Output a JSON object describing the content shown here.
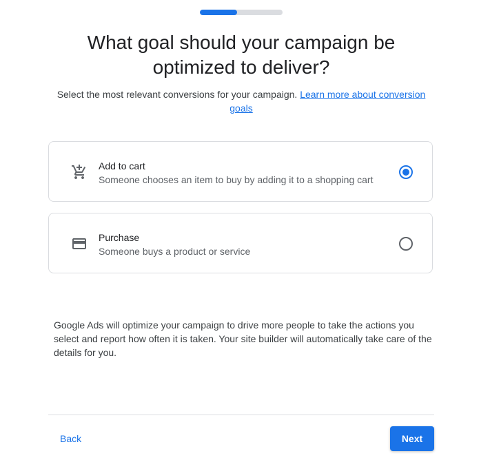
{
  "progress": {
    "fraction": 0.45,
    "track_color": "#dadce0",
    "fill_color": "#1a73e8"
  },
  "header": {
    "title": "What goal should your campaign be optimized to deliver?",
    "subtitle_text": "Select the most relevant conversions for your campaign.",
    "learn_more_link": "Learn more about conversion goals"
  },
  "options": [
    {
      "icon": "add-shopping-cart-icon",
      "label": "Add to cart",
      "description": "Someone chooses an item to buy by adding it to a shopping cart",
      "selected": true
    },
    {
      "icon": "credit-card-icon",
      "label": "Purchase",
      "description": "Someone buys a product or service",
      "selected": false
    }
  ],
  "info_text": "Google Ads will optimize your campaign to drive more people to take the actions you select and report how often it is taken. Your site builder will automatically take care of the details for you.",
  "footer": {
    "back_label": "Back",
    "next_label": "Next"
  },
  "colors": {
    "accent": "#1a73e8",
    "text_primary": "#202124",
    "text_secondary": "#5f6368",
    "border": "#dadce0"
  }
}
